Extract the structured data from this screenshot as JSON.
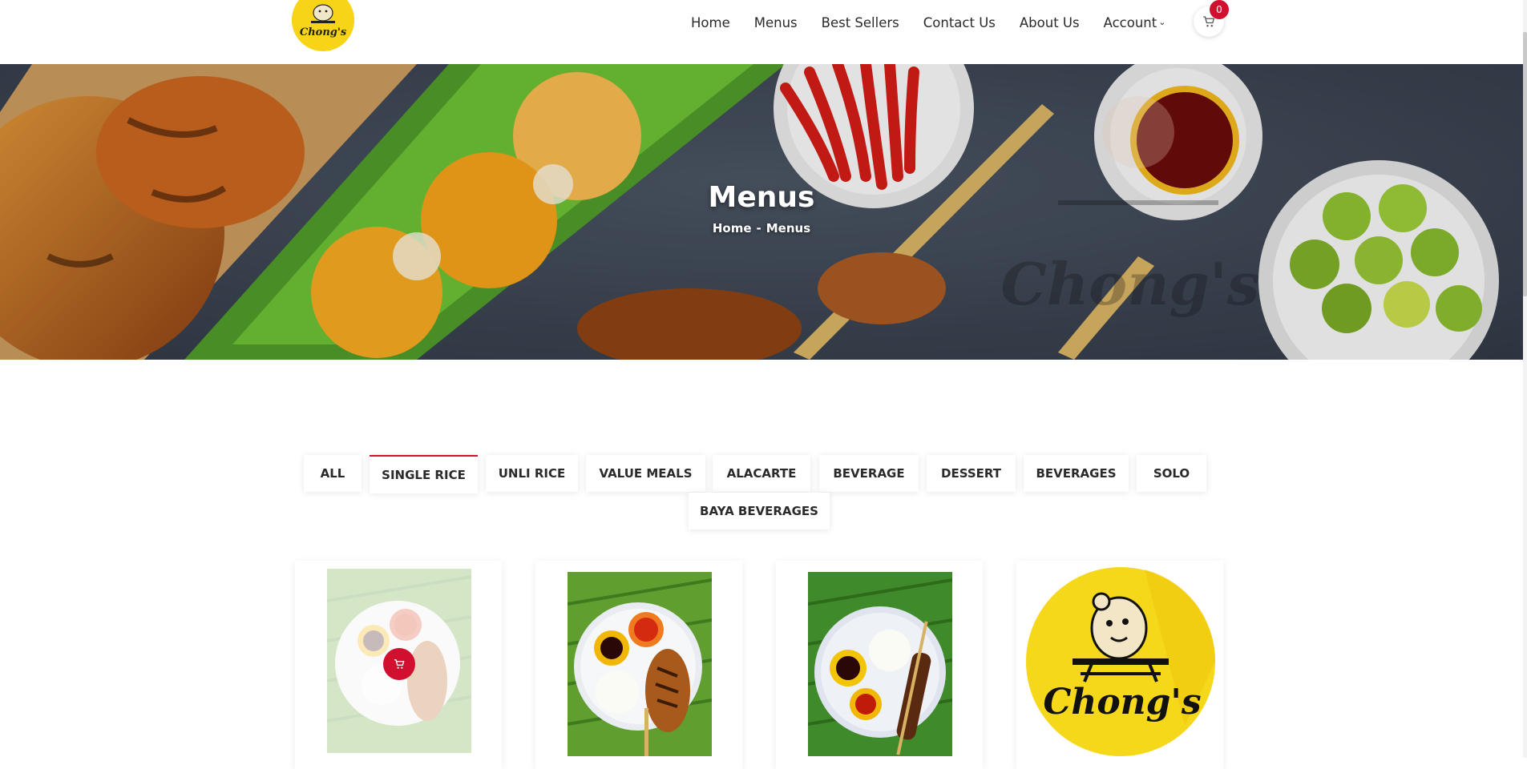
{
  "header": {
    "logo_text": "Chong's",
    "nav": [
      "Home",
      "Menus",
      "Best Sellers",
      "Contact Us",
      "About Us"
    ],
    "account_label": "Account",
    "cart_count": "0"
  },
  "hero": {
    "title": "Menus",
    "breadcrumb": {
      "home": "Home",
      "separator": "-",
      "current": "Menus"
    },
    "watermark_text": "Chong's"
  },
  "filters": {
    "items": [
      "ALL",
      "SINGLE RICE",
      "UNLI RICE",
      "VALUE MEALS",
      "ALACARTE",
      "BEVERAGE",
      "DESSERT",
      "BEVERAGES",
      "SOLO",
      "BAYA BEVERAGES"
    ],
    "active": "SINGLE RICE"
  },
  "cards": [
    {
      "image": "chicken-plate-photo",
      "state": "hover"
    },
    {
      "image": "chicken-plate-photo"
    },
    {
      "image": "pork-bbq-plate-photo"
    },
    {
      "image": "chongs-logo",
      "logo_text": "Chong's"
    }
  ],
  "colors": {
    "accent": "#d0102e",
    "brand_yellow": "#f7d417"
  }
}
